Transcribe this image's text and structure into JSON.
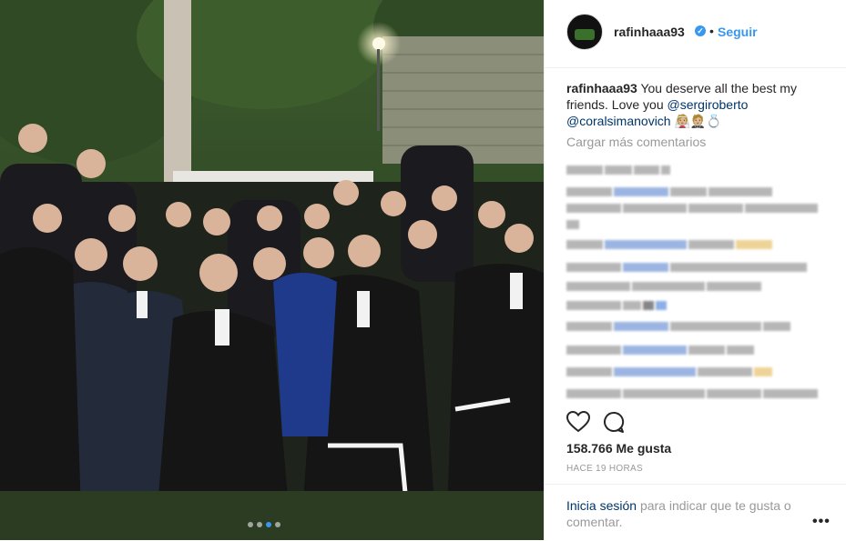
{
  "post": {
    "username": "rafinhaaa93",
    "follow_label": "Seguir",
    "separator": "•",
    "verified_mark": "✓",
    "caption_user": "rafinhaaa93",
    "caption_text": "You deserve all the best my friends. Love you",
    "mention_1": "@sergiroberto",
    "mention_2": "@coralsimanovich",
    "caption_emojis": "👰🏼🤵🏼💍",
    "load_more": "Cargar más comentarios",
    "likes": "158.766 Me gusta",
    "time_ago": "HACE 19 HORAS",
    "login_link": "Inicia sesión",
    "login_rest": "para indicar que te gusta o comentar.",
    "more_options": "•••"
  },
  "colors": {
    "accent": "#3897f0",
    "link": "#003569",
    "text": "#262626",
    "muted": "#999999"
  },
  "icons": {
    "like": "heart-icon",
    "comment": "comment-icon",
    "more": "more-options-icon",
    "verified": "verified-badge-icon"
  }
}
